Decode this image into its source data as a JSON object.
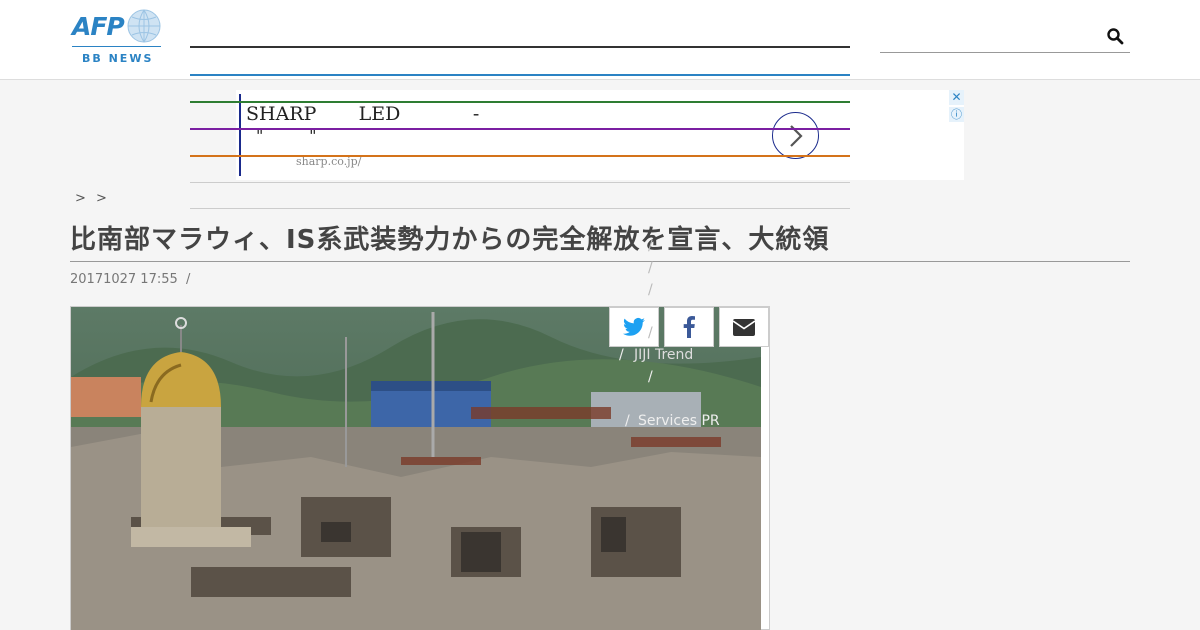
{
  "header": {
    "logo": {
      "word": "AFP",
      "subtitle": "BB NEWS"
    },
    "nav_line_colors": [
      "#333333",
      "#2b83c4",
      "#2e7d32",
      "#7b1fa2",
      "#d4731a"
    ],
    "search": {
      "placeholder": "",
      "value": ""
    }
  },
  "ad": {
    "title": "SHARP       LED            -",
    "subtitle": "\"         \"",
    "url": "sharp.co.jp/",
    "close_label": "✕",
    "info_label": "ⓘ",
    "accent": "#1a2a8c"
  },
  "breadcrumb": ">  >",
  "article": {
    "title": "比南部マラウィ、IS系武装勢力からの完全解放を宣言、大統領",
    "date": "20171027 17:55",
    "date_sep": "/"
  },
  "share": [
    {
      "icon": "twitter-icon",
      "color": "#1da1f2"
    },
    {
      "icon": "facebook-icon",
      "color": "#3b5998"
    },
    {
      "icon": "mail-icon",
      "color": "#333333"
    }
  ],
  "overlay_menu": {
    "slashes": [
      "/",
      "/",
      "/",
      "/",
      "/",
      "/",
      "/"
    ],
    "jiji_trend": "JIJI Trend",
    "services_pr": "Services PR"
  }
}
